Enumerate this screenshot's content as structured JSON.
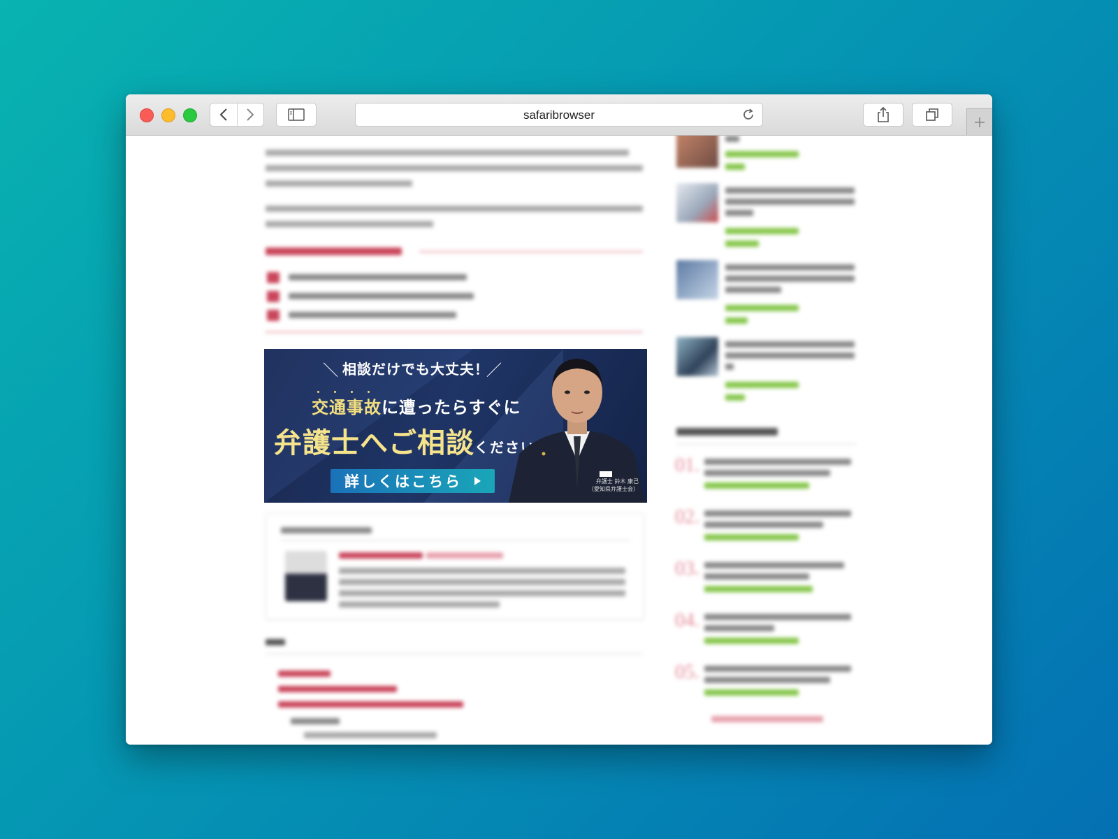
{
  "browser": {
    "address": "safaribrowser"
  },
  "banner": {
    "subtitle": "相談だけでも大丈夫！",
    "line1_highlight": "交通事故",
    "line1_rest": "に遭ったらすぐに",
    "line2_main": "弁護士へご相談",
    "line2_small": "ください",
    "cta": "詳しくはこちら",
    "caption_line1": "弁護士 鈴木 康己",
    "caption_line2": "（愛知県弁護士会）"
  },
  "colors": {
    "accent_red": "#c9455a",
    "accent_green": "#86c64b",
    "banner_gold": "#f3df80"
  },
  "ranking": {
    "numbers": [
      "01.",
      "02.",
      "03.",
      "04.",
      "05."
    ]
  }
}
